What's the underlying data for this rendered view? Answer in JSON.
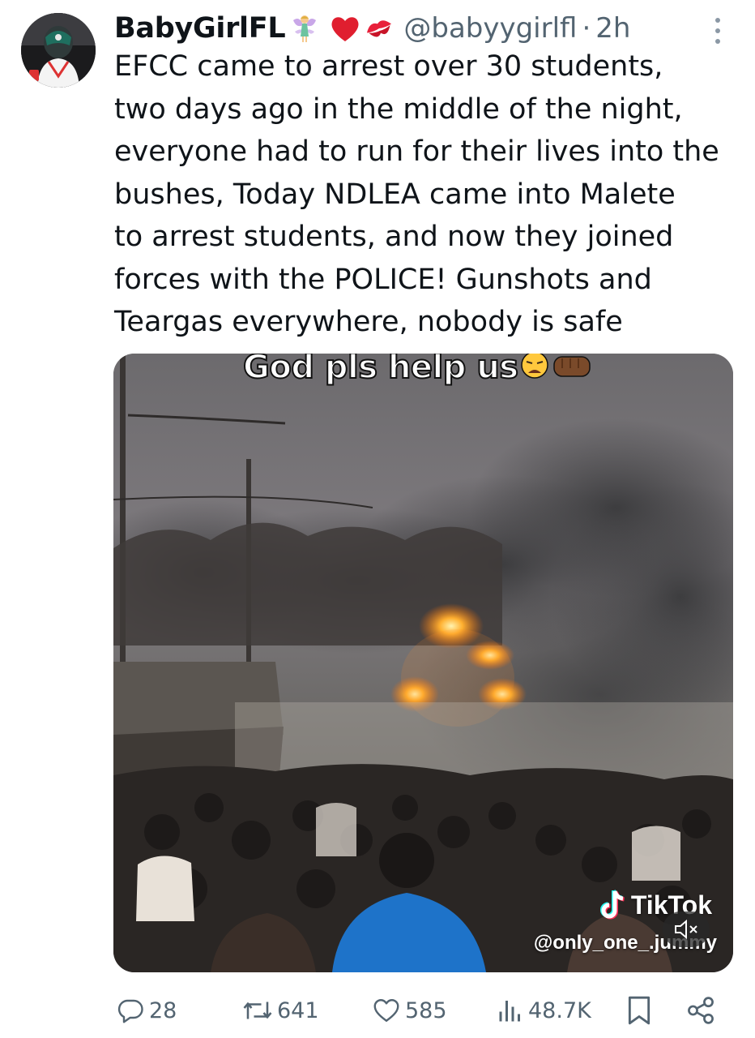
{
  "tweet": {
    "display_name": "BabyGirlFL",
    "name_emojis": [
      "fairy-emoji",
      "red-heart-emoji",
      "kiss-mark-emoji"
    ],
    "handle": "@babyygirlfl",
    "separator": "·",
    "time": "2h",
    "text": "EFCC came to arrest over 30 students,\ntwo days ago in the middle of the night,\neveryone had to run for their lives into the\nbushes, Today NDLEA came into Malete\nto arrest students, and now they joined\nforces with the POLICE! Gunshots and\nTeargas everywhere, nobody is safe"
  },
  "media": {
    "caption": "God pls help us",
    "caption_emojis": [
      "weary-face-emoji",
      "raised-fist-emoji"
    ],
    "watermark_brand": "TikTok",
    "watermark_user": "@only_one_.jummy",
    "mute_icon": "speaker-muted-icon"
  },
  "actions": {
    "replies": "28",
    "reposts": "641",
    "likes": "585",
    "views": "48.7K"
  },
  "colors": {
    "text_primary": "#0f1419",
    "text_secondary": "#536471",
    "heart": "#e0245e"
  }
}
